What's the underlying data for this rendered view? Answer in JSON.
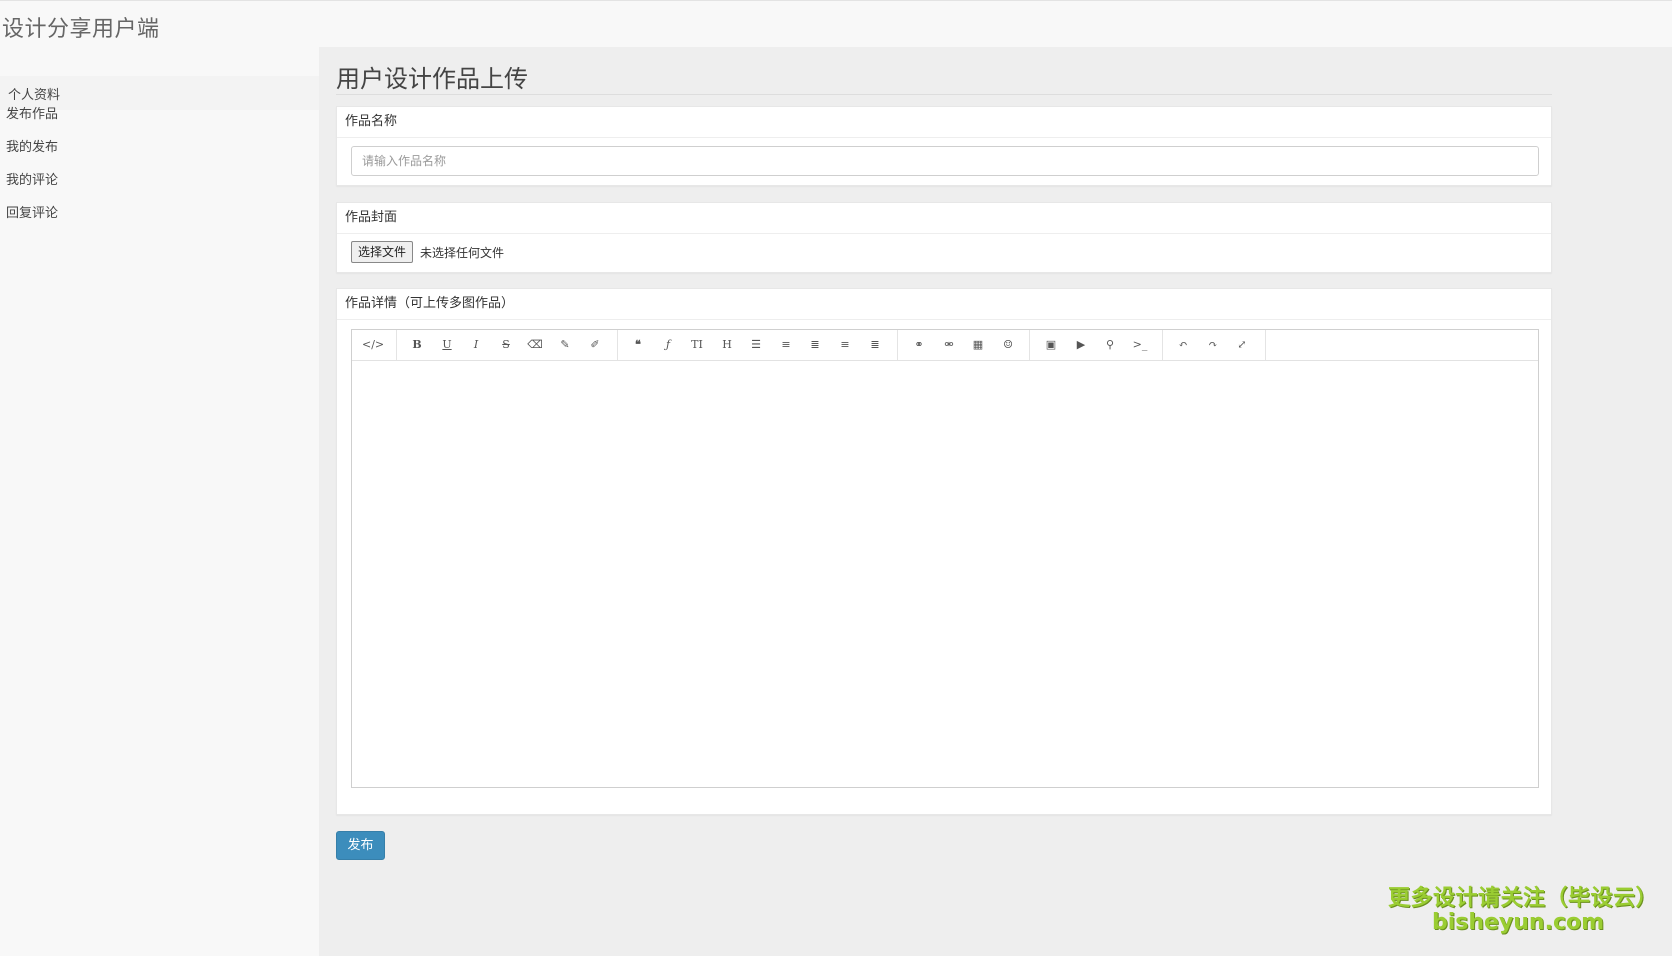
{
  "app": {
    "brand": "设计分享用户端"
  },
  "sidebar": {
    "items": [
      {
        "label": "个人资料"
      },
      {
        "label": "发布作品"
      },
      {
        "label": "我的发布"
      },
      {
        "label": "我的评论"
      },
      {
        "label": "回复评论"
      }
    ]
  },
  "page": {
    "title": "用户设计作品上传"
  },
  "form": {
    "name_label": "作品名称",
    "name_placeholder": "请输入作品名称",
    "name_value": "",
    "cover_label": "作品封面",
    "file_button": "选择文件",
    "file_status": "未选择任何文件",
    "detail_label": "作品详情（可上传多图作品）",
    "submit_label": "发布"
  },
  "toolbar": {
    "items": [
      "source",
      "bold",
      "underline",
      "italic",
      "strikethrough",
      "eraser",
      "pencil",
      "brush",
      "quote",
      "font",
      "font-size",
      "heading",
      "unordered-list",
      "ordered-list",
      "align-left",
      "align-center",
      "align-right",
      "link",
      "unlink",
      "table",
      "emoji",
      "image",
      "video",
      "map",
      "code",
      "undo",
      "redo",
      "fullscreen"
    ]
  },
  "watermark": {
    "line1": "更多设计请关注（毕设云）",
    "line2": "bisheyun.com"
  },
  "colors": {
    "accent": "#3c8dbc",
    "watermark": "#9acd32"
  }
}
